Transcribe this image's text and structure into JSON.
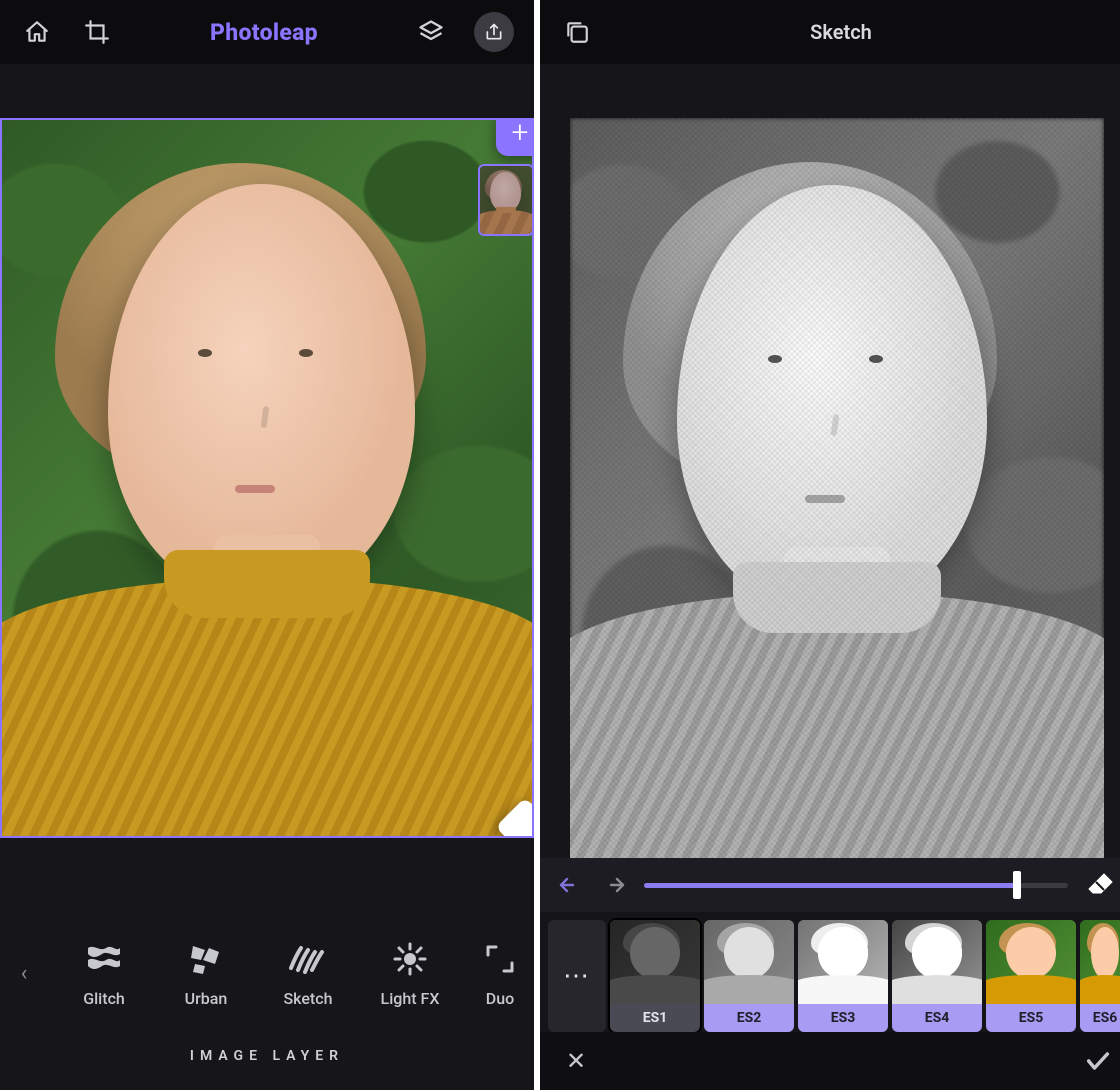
{
  "left": {
    "app_title": "Photoleap",
    "icons": {
      "home": "home-icon",
      "crop": "crop-icon",
      "layers": "layers-icon",
      "share": "share-icon",
      "add": "+",
      "eraser": "eraser-icon",
      "chevL": "‹"
    },
    "effects": [
      {
        "name": "Glitch",
        "icon": "glitch"
      },
      {
        "name": "Urban",
        "icon": "urban"
      },
      {
        "name": "Sketch",
        "icon": "sketch"
      },
      {
        "name": "Light FX",
        "icon": "lightfx"
      },
      {
        "name": "Duo",
        "icon": "duo"
      }
    ],
    "layer_label": "IMAGE LAYER"
  },
  "right": {
    "title": "Sketch",
    "icons": {
      "collection": "collection-icon",
      "undo": "undo-icon",
      "redo": "redo-icon",
      "eraser": "eraser-icon",
      "close": "✕",
      "confirm": "✓",
      "more": "⋯"
    },
    "slider_percent": 88,
    "presets": [
      {
        "label": "ES1",
        "selected": true,
        "style": "gray dark"
      },
      {
        "label": "ES2",
        "selected": false,
        "style": "gray"
      },
      {
        "label": "ES3",
        "selected": false,
        "style": "line"
      },
      {
        "label": "ES4",
        "selected": false,
        "style": "ink"
      },
      {
        "label": "ES5",
        "selected": false,
        "style": "color"
      },
      {
        "label": "ES6",
        "selected": false,
        "style": "color",
        "partial": true
      }
    ]
  }
}
